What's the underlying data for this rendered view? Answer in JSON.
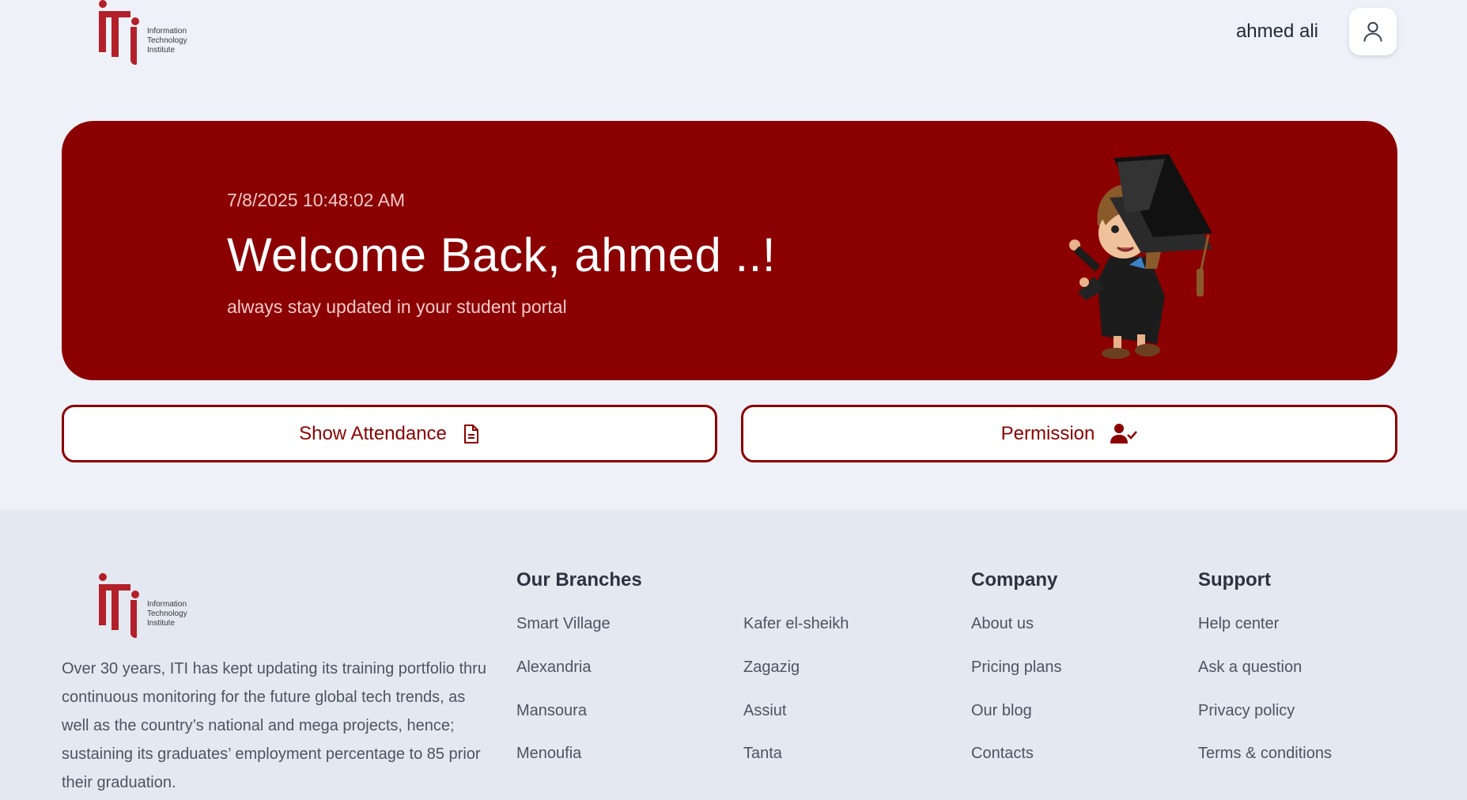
{
  "header": {
    "logo_lines": [
      "Information",
      "Technology",
      "Institute"
    ],
    "user_name": "ahmed ali",
    "user_icon": "user-icon"
  },
  "hero": {
    "datetime": "7/8/2025 10:48:02 AM",
    "title": "Welcome Back, ahmed ..!",
    "subtitle": "always stay updated in your student portal",
    "background": "#8b0000"
  },
  "actions": {
    "attendance_label": "Show Attendance",
    "attendance_icon": "document-icon",
    "permission_label": "Permission",
    "permission_icon": "user-check-icon"
  },
  "footer": {
    "logo_lines": [
      "Information",
      "Technology",
      "Institute"
    ],
    "description": "Over 30 years, ITI has kept updating its training portfolio thru continuous monitoring for the future global tech trends, as well as the country’s national and mega projects, hence; sustaining its graduates’ employment percentage to 85 prior their graduation.",
    "branches_title": "Our Branches",
    "branches_col1": [
      "Smart Village",
      "Alexandria",
      "Mansoura",
      "Menoufia"
    ],
    "branches_col2": [
      "Kafer el-sheikh",
      "Zagazig",
      "Assiut",
      "Tanta"
    ],
    "company_title": "Company",
    "company_links": [
      "About us",
      "Pricing plans",
      "Our blog",
      "Contacts"
    ],
    "support_title": "Support",
    "support_links": [
      "Help center",
      "Ask a question",
      "Privacy policy",
      "Terms & conditions"
    ]
  }
}
